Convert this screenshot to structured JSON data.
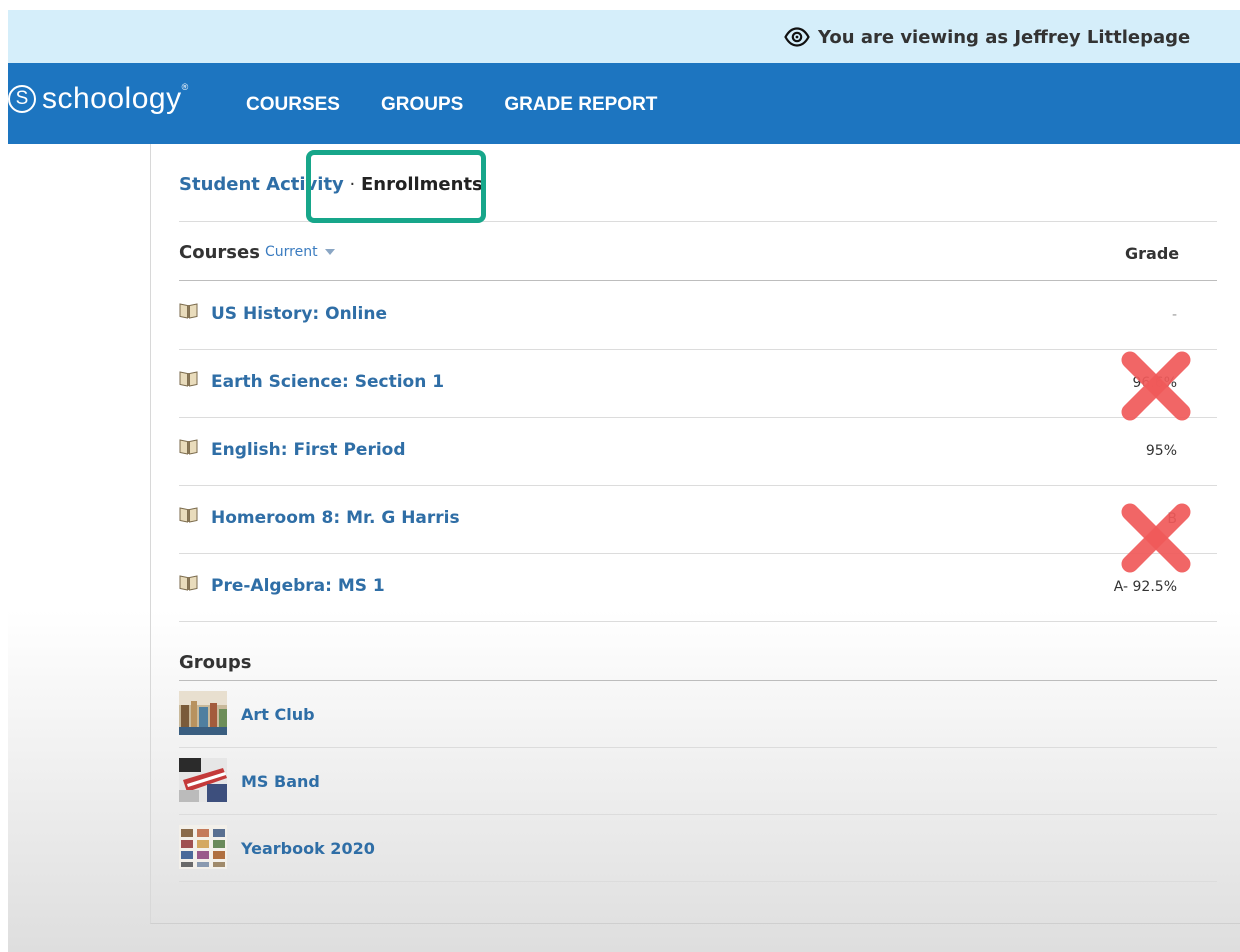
{
  "masquerade": {
    "text": "You are viewing as Jeffrey Littlepage",
    "icon": "eye-icon"
  },
  "header": {
    "logo_text": "schoology",
    "logo_mark": "S",
    "nav": [
      "COURSES",
      "GROUPS",
      "GRADE REPORT"
    ],
    "bg_color": "#1d75c0"
  },
  "breadcrumb": {
    "parent": "Student Activity",
    "separator": "·",
    "current": "Enrollments"
  },
  "courses": {
    "title": "Courses",
    "filter": "Current",
    "grade_header": "Grade",
    "items": [
      {
        "name": "US History: Online",
        "grade": "-"
      },
      {
        "name": "Earth Science: Section 1",
        "grade": "96.6%"
      },
      {
        "name": "English: First Period",
        "grade": "95%"
      },
      {
        "name": "Homeroom 8: Mr. G Harris",
        "grade": "B"
      },
      {
        "name": "Pre-Algebra: MS 1",
        "grade": "A- 92.5%"
      }
    ]
  },
  "groups": {
    "title": "Groups",
    "items": [
      {
        "name": "Art Club"
      },
      {
        "name": "MS Band"
      },
      {
        "name": "Yearbook 2020"
      }
    ]
  },
  "annotations": {
    "highlight_color": "#17a68a",
    "x_mark_color": "#f05a5a"
  }
}
